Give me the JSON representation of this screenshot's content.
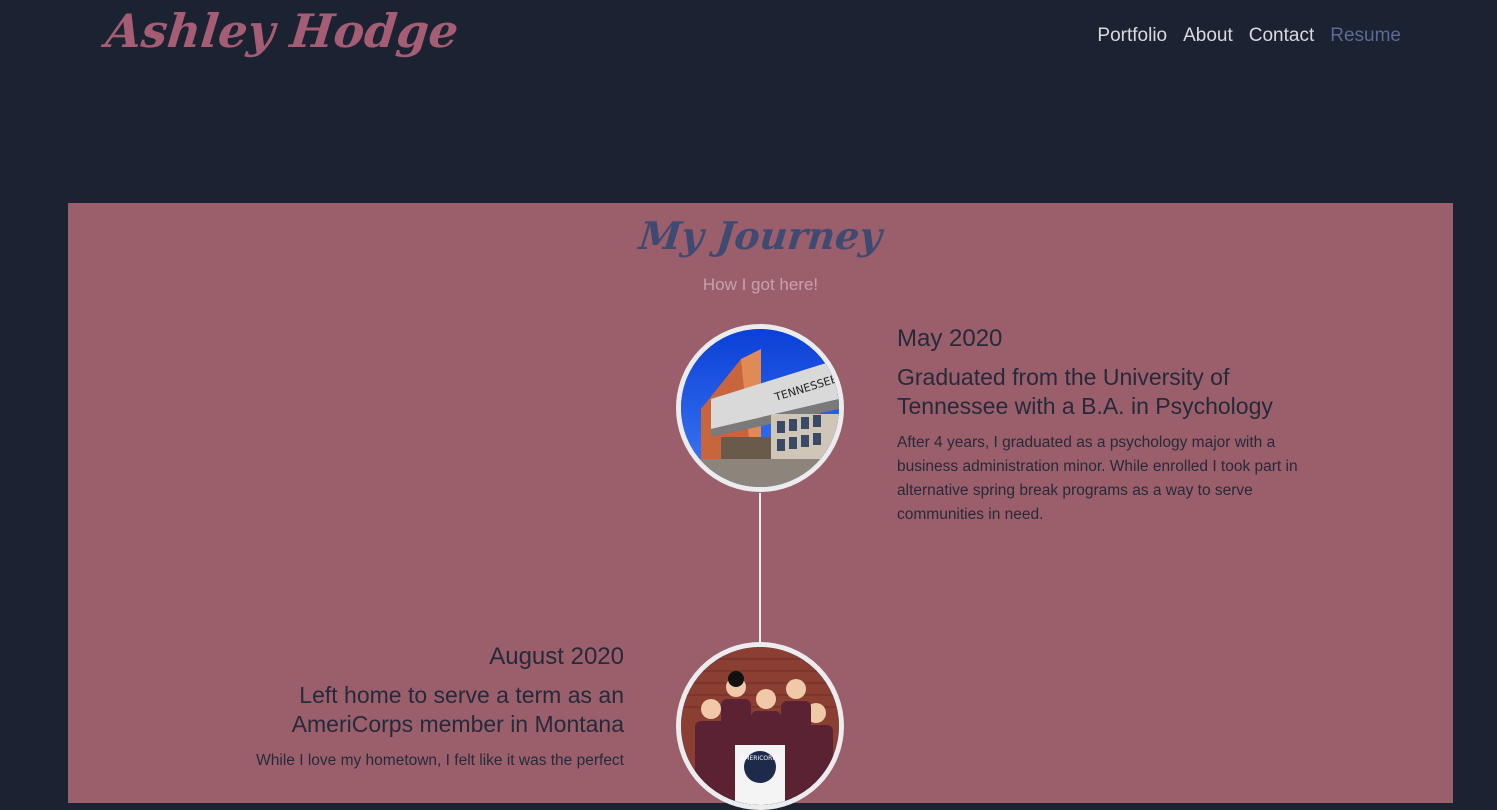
{
  "navbar": {
    "brand": "Ashley Hodge",
    "links": [
      {
        "label": "Portfolio"
      },
      {
        "label": "About"
      },
      {
        "label": "Contact"
      },
      {
        "label": "Resume",
        "active": true
      }
    ]
  },
  "journey": {
    "title": "My Journey",
    "subtitle": "How I got here!",
    "entries": [
      {
        "date": "May 2020",
        "heading": "Graduated from the University of Tennessee with a B.A. in Psychology",
        "body": "After 4 years, I graduated as a psychology major with a business administration minor. While enrolled I took part in alternative spring break programs as a way to serve communities in need.",
        "image_sign_text": "TENNESSEE"
      },
      {
        "date": "August 2020",
        "heading": "Left home to serve a term as an AmeriCorps member in Montana",
        "body": "While I love my hometown, I felt like it was the perfect",
        "image_sign_text": "AMERICORPS"
      }
    ]
  },
  "colors": {
    "background": "#1b2232",
    "accent": "#a45d72",
    "section_bg": "#9b5f6c",
    "title": "#3f4a73",
    "nav_active": "#5d6a93"
  }
}
